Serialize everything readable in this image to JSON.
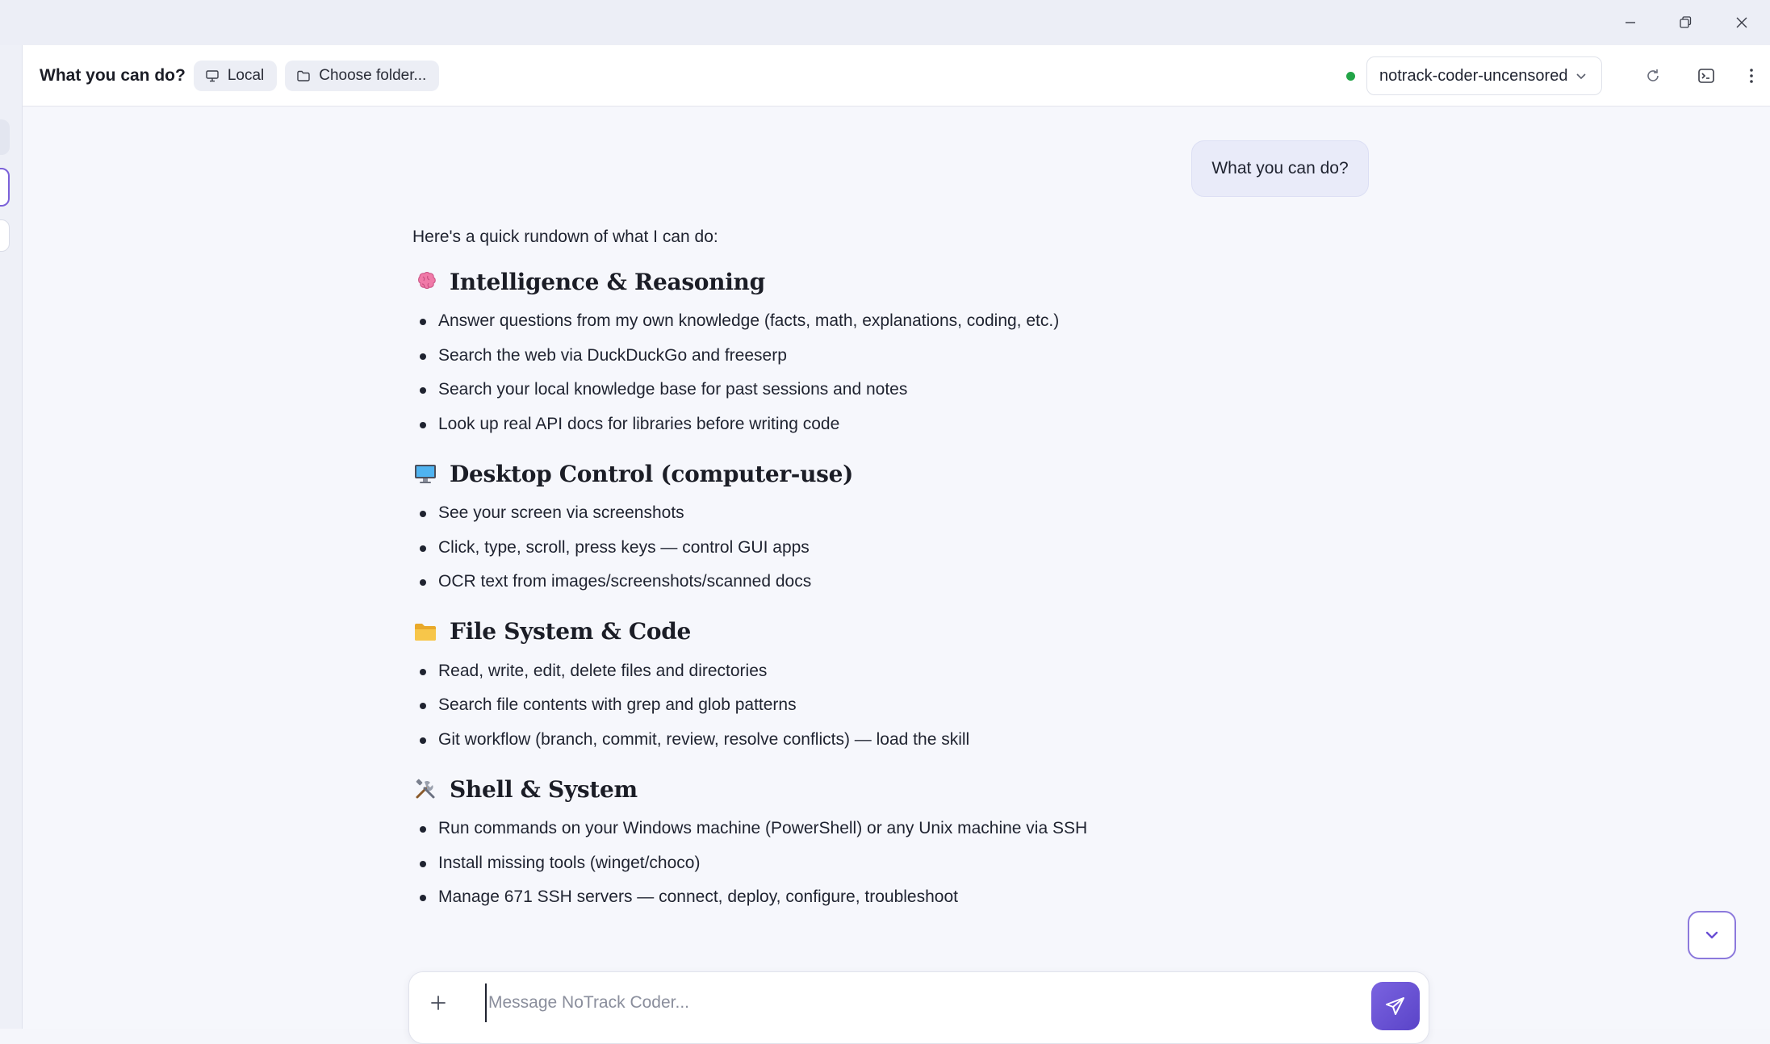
{
  "window": {
    "controls": [
      "minimize-icon",
      "restore-icon",
      "close-icon"
    ]
  },
  "header": {
    "conversation_title": "What you can do?",
    "location_chip": {
      "label": "Local",
      "icon": "monitor-icon"
    },
    "folder_chip": {
      "label": "Choose folder...",
      "icon": "folder-icon"
    },
    "model": {
      "status": "online",
      "status_color": "#22a447",
      "selected": "notrack-coder-uncensored"
    },
    "actions": [
      "refresh-icon",
      "terminal-icon",
      "more-vertical-icon"
    ]
  },
  "chat": {
    "user_message": "What you can do?",
    "assistant": {
      "intro": "Here's a quick rundown of what I can do:",
      "sections": [
        {
          "icon": "brain-icon",
          "title": "Intelligence & Reasoning",
          "items": [
            "Answer questions from my own knowledge (facts, math, explanations, coding, etc.)",
            "Search the web via DuckDuckGo and freeserp",
            "Search your local knowledge base for past sessions and notes",
            "Look up real API docs for libraries before writing code"
          ]
        },
        {
          "icon": "desktop-computer-icon",
          "title": "Desktop Control (computer-use)",
          "items": [
            "See your screen via screenshots",
            "Click, type, scroll, press keys — control GUI apps",
            "OCR text from images/screenshots/scanned docs"
          ]
        },
        {
          "icon": "folder-icon",
          "title": "File System & Code",
          "items": [
            "Read, write, edit, delete files and directories",
            "Search file contents with grep and glob patterns",
            "Git workflow (branch, commit, review, resolve conflicts) — load the skill"
          ]
        },
        {
          "icon": "tools-icon",
          "title": "Shell & System",
          "items": [
            "Run commands on your Windows machine (PowerShell) or any Unix machine via SSH",
            "Install missing tools (winget/choco)",
            "Manage 671 SSH servers — connect, deploy, configure, troubleshoot"
          ]
        }
      ]
    }
  },
  "composer": {
    "placeholder": "Message NoTrack Coder...",
    "value": "",
    "accent": "#6a4fd4"
  }
}
